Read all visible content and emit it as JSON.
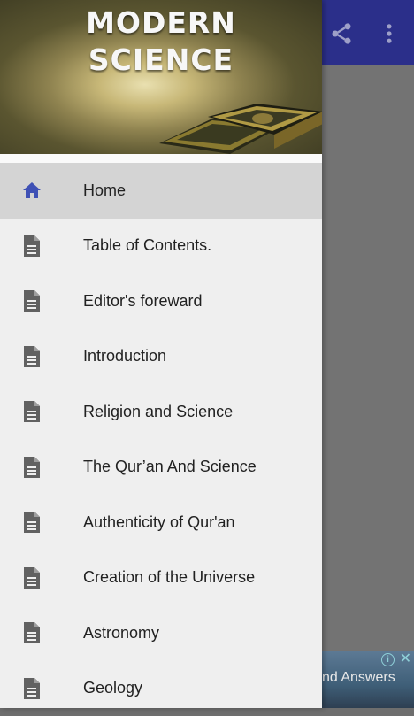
{
  "header": {
    "title_line1": "MODERN",
    "title_line2": "SCIENCE"
  },
  "appbar": {
    "share_icon": "share-icon",
    "more_icon": "more-vert-icon"
  },
  "menu": {
    "items": [
      {
        "label": "Home",
        "icon": "home-icon",
        "active": true
      },
      {
        "label": "Table of Contents.",
        "icon": "document-icon"
      },
      {
        "label": "Editor's foreward",
        "icon": "document-icon"
      },
      {
        "label": "Introduction",
        "icon": "document-icon"
      },
      {
        "label": "Religion and Science",
        "icon": "document-icon"
      },
      {
        "label": "The Qur’an And Science",
        "icon": "document-icon"
      },
      {
        "label": "Authenticity of Qur'an",
        "icon": "document-icon"
      },
      {
        "label": "Creation of the Universe",
        "icon": "document-icon"
      },
      {
        "label": "Astronomy",
        "icon": "document-icon"
      },
      {
        "label": "Geology",
        "icon": "document-icon"
      }
    ]
  },
  "ad": {
    "text": "nd Answers",
    "info_glyph": "i",
    "close_glyph": "✕"
  },
  "colors": {
    "appbar": "#2b2f8a",
    "active_icon": "#3f51b5",
    "doc_icon": "#616161",
    "drawer_bg": "#efefef",
    "active_row": "#d4d4d4"
  }
}
